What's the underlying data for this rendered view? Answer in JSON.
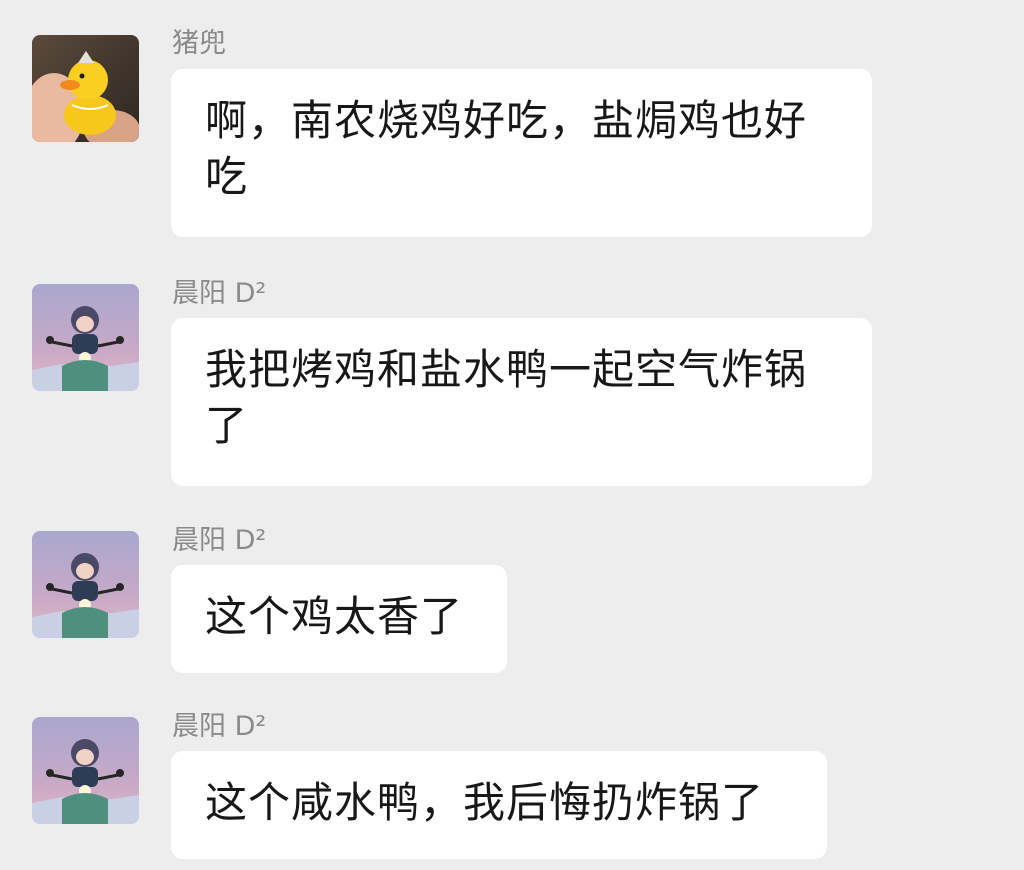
{
  "messages": [
    {
      "sender": "猪兜",
      "avatar_icon": "duck-avatar-icon",
      "text": "啊，南农烧鸡好吃，盐焗鸡也好吃"
    },
    {
      "sender": "晨阳 D²",
      "avatar_icon": "scooter-girl-avatar-icon",
      "text": "我把烤鸡和盐水鸭一起空气炸锅了"
    },
    {
      "sender": "晨阳 D²",
      "avatar_icon": "scooter-girl-avatar-icon",
      "text": "这个鸡太香了"
    },
    {
      "sender": "晨阳 D²",
      "avatar_icon": "scooter-girl-avatar-icon",
      "text": "这个咸水鸭，我后悔扔炸锅了"
    }
  ],
  "colors": {
    "background": "#ededed",
    "bubble": "#ffffff",
    "sender_text": "#8a8a8a",
    "message_text": "#181818"
  }
}
